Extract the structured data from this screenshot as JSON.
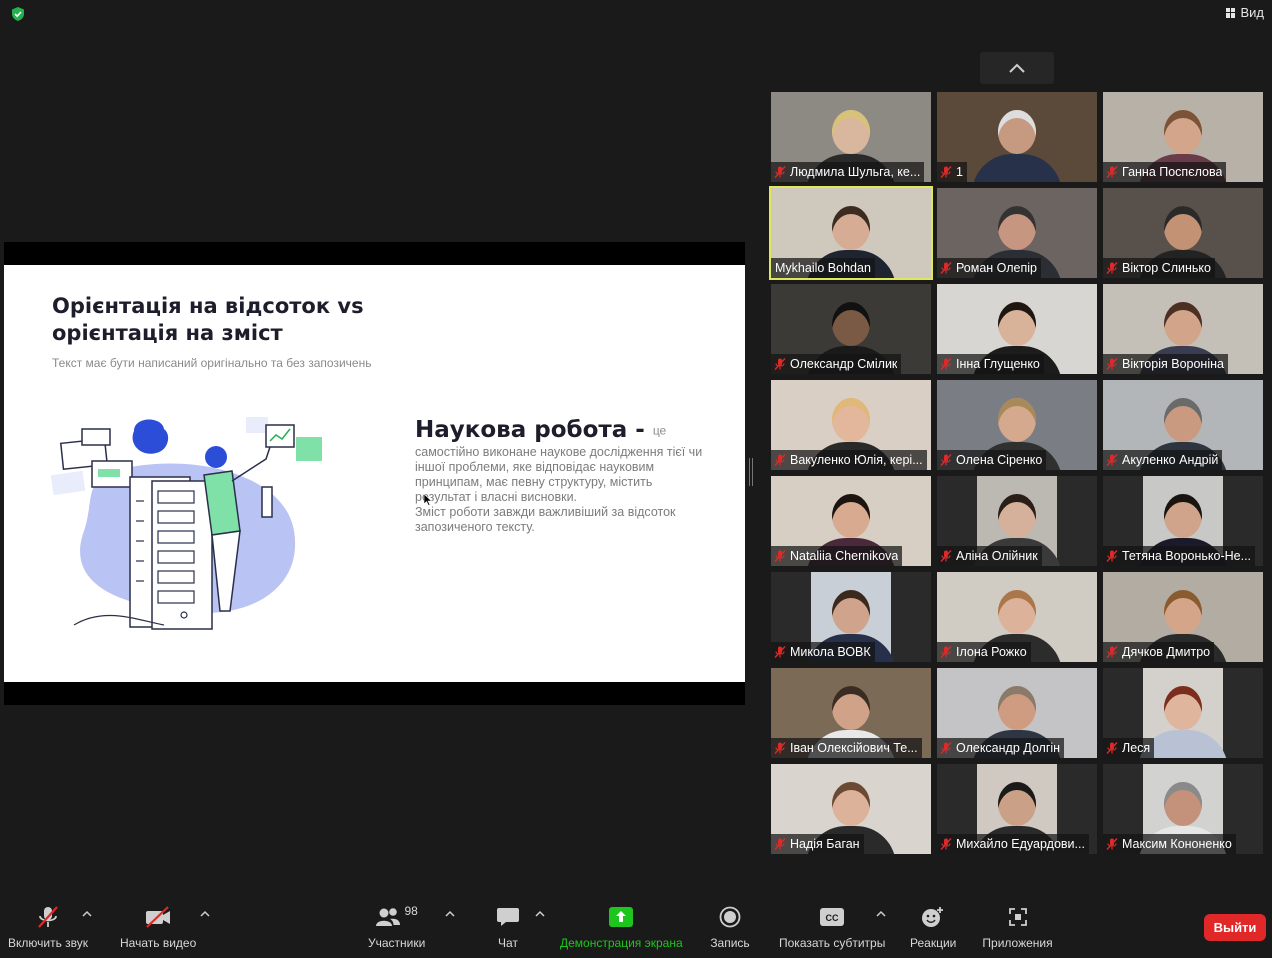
{
  "window": {
    "view_label": "Вид"
  },
  "slide": {
    "title": "Орієнтація на відсоток vs орієнтація на зміст",
    "subtitle": "Текст має бути написаний оригінально та без запозичень",
    "heading": "Наукова робота -",
    "heading_suffix": "це",
    "body_line1": "самостійно виконане наукове дослідження тієї чи іншої проблеми, яке відповідає науковим принципам,  має певну структуру, містить результат і власні висновки.",
    "body_line2": "Зміст роботи завжди важливіший за відсоток запозиченого тексту."
  },
  "participants": [
    {
      "name": "Людмила Шульга, ке...",
      "bg": "#8d8a84",
      "skin": "#d9b79f",
      "cloth": "#2a2a2a",
      "hair": "#d8c27a",
      "narrow": false
    },
    {
      "name": "1",
      "bg": "#5b4a3a",
      "skin": "#c69a80",
      "cloth": "#27324a",
      "hair": "#dddddd",
      "narrow": false
    },
    {
      "name": "Ганна Поспєлова",
      "bg": "#b7b1a8",
      "skin": "#d3a58a",
      "cloth": "#6a3c4a",
      "hair": "#7a5338",
      "narrow": false
    },
    {
      "name": "Mykhailo Bohdan",
      "bg": "#cfc8bc",
      "skin": "#d6ad94",
      "cloth": "#1e2530",
      "hair": "#3b2b20",
      "narrow": false,
      "speaking": true
    },
    {
      "name": "Роман Олепір",
      "bg": "#6b6461",
      "skin": "#c79680",
      "cloth": "#2b2f35",
      "hair": "#333333",
      "narrow": false
    },
    {
      "name": "Віктор Слинько",
      "bg": "#58504a",
      "skin": "#c39275",
      "cloth": "#232323",
      "hair": "#2a2a2a",
      "narrow": false
    },
    {
      "name": "Олександр Смілик",
      "bg": "#3b3a36",
      "skin": "#7a5a45",
      "cloth": "#1a1a1a",
      "hair": "#111111",
      "narrow": false
    },
    {
      "name": "Інна Глущенко",
      "bg": "#d8d6d2",
      "skin": "#d9b29a",
      "cloth": "#1c1c1c",
      "hair": "#1e1610",
      "narrow": false
    },
    {
      "name": "Вікторія Вороніна",
      "bg": "#c4c0b8",
      "skin": "#d2a48a",
      "cloth": "#3a3d52",
      "hair": "#4a2f22",
      "narrow": false
    },
    {
      "name": "Вакуленко Юлія, кері...",
      "bg": "#d9cfc4",
      "skin": "#e2b79c",
      "cloth": "#2a2a2a",
      "hair": "#e0b87a",
      "narrow": false
    },
    {
      "name": "Олена Сіренко",
      "bg": "#7a7e84",
      "skin": "#d4a98e",
      "cloth": "#303030",
      "hair": "#a88a5a",
      "narrow": false
    },
    {
      "name": "Акуленко Андрій",
      "bg": "#b3b6b8",
      "skin": "#c99a80",
      "cloth": "#2d3640",
      "hair": "#6a6a6a",
      "narrow": false
    },
    {
      "name": "Nataliia Chernikova",
      "bg": "#d7cfc4",
      "skin": "#d8ab90",
      "cloth": "#4a2a3a",
      "hair": "#1c1410",
      "narrow": false
    },
    {
      "name": "Аліна Олійник",
      "bg": "#bcb8b2",
      "skin": "#d5b09a",
      "cloth": "#3a3a3a",
      "hair": "#2a1e18",
      "narrow": true
    },
    {
      "name": "Тетяна Воронько-Не...",
      "bg": "#c8c8c6",
      "skin": "#d0a48a",
      "cloth": "#1a1a2a",
      "hair": "#1a1410",
      "narrow": true
    },
    {
      "name": "Микола ВОВК",
      "bg": "#c9cfd6",
      "skin": "#d0a48c",
      "cloth": "#27304a",
      "hair": "#3a2a1e",
      "narrow": true
    },
    {
      "name": "Ілона Рожко",
      "bg": "#d0ccc4",
      "skin": "#dcb39a",
      "cloth": "#2c2c2c",
      "hair": "#a9774a",
      "narrow": false
    },
    {
      "name": "Дячков Дмитро",
      "bg": "#b2aca2",
      "skin": "#d5a58a",
      "cloth": "#2a2a2a",
      "hair": "#8a5a30",
      "narrow": false
    },
    {
      "name": "Іван Олексійович Те...",
      "bg": "#7b6a56",
      "skin": "#d0a288",
      "cloth": "#e8e8ea",
      "hair": "#3a2c22",
      "narrow": false
    },
    {
      "name": "Олександр Долгін",
      "bg": "#c4c4c6",
      "skin": "#cf9c82",
      "cloth": "#2e3644",
      "hair": "#8a7a6a",
      "narrow": false
    },
    {
      "name": "Леся",
      "bg": "#d4d0cc",
      "skin": "#e0b59e",
      "cloth": "#b8c2d4",
      "hair": "#7a2e1e",
      "narrow": true
    },
    {
      "name": "Надія Баган",
      "bg": "#d9d4ce",
      "skin": "#dcb29a",
      "cloth": "#2a2a2a",
      "hair": "#6a4a32",
      "narrow": false
    },
    {
      "name": "Михайло Едуардови...",
      "bg": "#cfc9c2",
      "skin": "#caa086",
      "cloth": "#2a2a2a",
      "hair": "#1a1a1a",
      "narrow": true
    },
    {
      "name": "Максим Кононенко",
      "bg": "#d2d2d0",
      "skin": "#c4917a",
      "cloth": "#e6e6e6",
      "hair": "#8a8a8a",
      "narrow": true
    }
  ],
  "toolbar": {
    "audio_label": "Включить звук",
    "video_label": "Начать видео",
    "participants_label": "Участники",
    "participants_count": "98",
    "chat_label": "Чат",
    "share_label": "Демонстрация экрана",
    "record_label": "Запись",
    "captions_label": "Показать субтитры",
    "cc_text": "CC",
    "reactions_label": "Реакции",
    "apps_label": "Приложения",
    "leave_label": "Выйти"
  },
  "colors": {
    "background": "#1a1a1a",
    "active_speaker": "#dfe85b",
    "share_green": "#1ec51e",
    "leave_red": "#e02828",
    "muted_red": "#e02828"
  }
}
